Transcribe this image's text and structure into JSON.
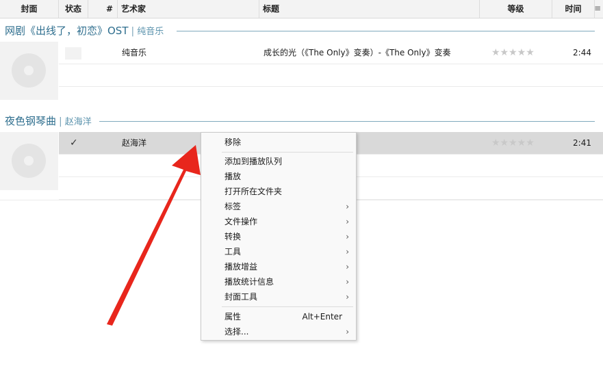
{
  "columns": {
    "cover": "封面",
    "status": "状态",
    "num": "#",
    "artist": "艺术家",
    "title": "标题",
    "rating": "等级",
    "time": "时间"
  },
  "groups": [
    {
      "album": "网剧《出线了，初恋》OST",
      "separator": "|",
      "artist": "纯音乐",
      "track": {
        "status": "",
        "artist": "纯音乐",
        "title": "成长的光（《The Only》变奏）-《The Only》变奏",
        "rating": "★★★★★",
        "rating_value": 0,
        "time": "2:44"
      }
    },
    {
      "album": "夜色钢琴曲",
      "separator": "|",
      "artist": "赵海洋",
      "track": {
        "status": "✓",
        "artist": "赵海洋",
        "title": "",
        "rating": "★★★★★",
        "rating_value": 0,
        "time": "2:41"
      }
    }
  ],
  "context_menu": {
    "items": [
      {
        "label": "移除",
        "shortcut": "",
        "submenu": false
      },
      {
        "label": "添加到播放队列",
        "shortcut": "",
        "submenu": false
      },
      {
        "label": "播放",
        "shortcut": "",
        "submenu": false
      },
      {
        "label": "打开所在文件夹",
        "shortcut": "",
        "submenu": false
      },
      {
        "label": "标签",
        "shortcut": "",
        "submenu": true
      },
      {
        "label": "文件操作",
        "shortcut": "",
        "submenu": true
      },
      {
        "label": "转换",
        "shortcut": "",
        "submenu": true
      },
      {
        "label": "工具",
        "shortcut": "",
        "submenu": true
      },
      {
        "label": "播放增益",
        "shortcut": "",
        "submenu": true
      },
      {
        "label": "播放统计信息",
        "shortcut": "",
        "submenu": true
      },
      {
        "label": "封面工具",
        "shortcut": "",
        "submenu": true
      },
      {
        "label": "属性",
        "shortcut": "Alt+Enter",
        "submenu": false
      },
      {
        "label": "选择...",
        "shortcut": "",
        "submenu": true
      }
    ],
    "submenu_arrow": "›"
  },
  "header_menu_icon": "≡",
  "colors": {
    "group_title": "#2e6e8e",
    "selected_row": "#d9d9d9",
    "annotation_arrow": "#e8261c"
  }
}
